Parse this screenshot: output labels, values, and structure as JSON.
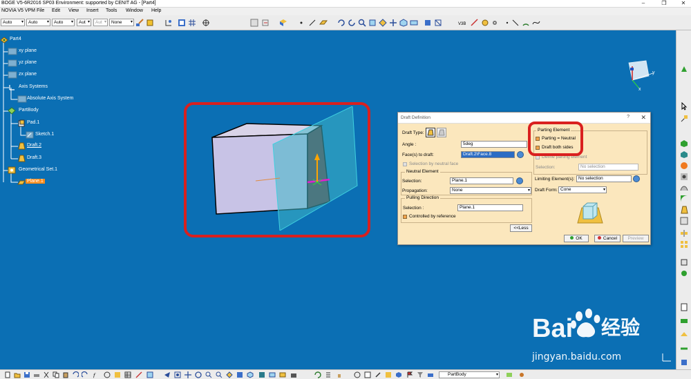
{
  "window": {
    "title": "BOGE V5-6R2016 SP03 Environment: supported by CENIT AG - [Part4]",
    "minimize": "–",
    "maximize": "❐",
    "close": "✕"
  },
  "menu": {
    "items": [
      "NOVIA V5 VPM",
      "File",
      "Edit",
      "View",
      "Insert",
      "Tools",
      "Window",
      "Help"
    ]
  },
  "toolbar": {
    "selects": [
      "Auto",
      "Auto",
      "Auto",
      "Aut",
      "Aut",
      "None"
    ]
  },
  "tree": {
    "root": "Part4",
    "xy_plane": "xy plane",
    "yz_plane": "yz plane",
    "zx_plane": "zx plane",
    "axis_systems": "Axis Systems",
    "absolute_axis": "Absolute Axis System",
    "partbody": "PartBody",
    "pad": "Pad.1",
    "sketch": "Sketch.1",
    "draft2": "Draft.2",
    "draft3": "Draft.3",
    "geoset": "Geometrical Set.1",
    "plane1": "Plane.1"
  },
  "compass": {
    "x_label": "x",
    "y_label": "y"
  },
  "dialog": {
    "title": "Draft Definition",
    "help": "?",
    "close": "✕",
    "draft_type_label": "Draft Type:",
    "angle_label": "Angle :",
    "angle_value": "5deg",
    "faces_label": "Face(s) to draft:",
    "faces_value": "Draft.2\\Face.8",
    "selection_by_neutral": "Selection by neutral face",
    "neutral_group": "Neutral Element",
    "neutral_selection_label": "Selection:",
    "neutral_selection_value": "Plane.1",
    "propagation_label": "Propagation:",
    "propagation_value": "None",
    "pulling_group": "Pulling Direction",
    "pulling_selection_label": "Selection :",
    "pulling_selection_value": "Plane.1",
    "controlled_by_reference": "Controlled by reference",
    "less_button": "<<Less",
    "parting_group": "Parting Element",
    "parting_neutral": "Parting = Neutral",
    "draft_both_sides": "Draft both sides",
    "define_parting": "Define parting element",
    "parting_selection_label": "Selection:",
    "parting_selection_value": "No selection",
    "limiting_label": "Limiting Element(s):",
    "limiting_value": "No selection",
    "draft_form_label": "Draft Form:",
    "draft_form_value": "Cone",
    "ok": "OK",
    "cancel": "Cancel",
    "preview": "Preview"
  },
  "statusbar": {
    "combo_value": "PartBody"
  },
  "watermark": {
    "brand": "Bai",
    "brand_cn": "经验",
    "url": "jingyan.baidu.com"
  },
  "colors": {
    "viewport": "#0b6fb4",
    "highlight": "#d9201f",
    "dialog_bg": "#fbe7bd",
    "selected_tree_item": "#ff8c1a"
  }
}
